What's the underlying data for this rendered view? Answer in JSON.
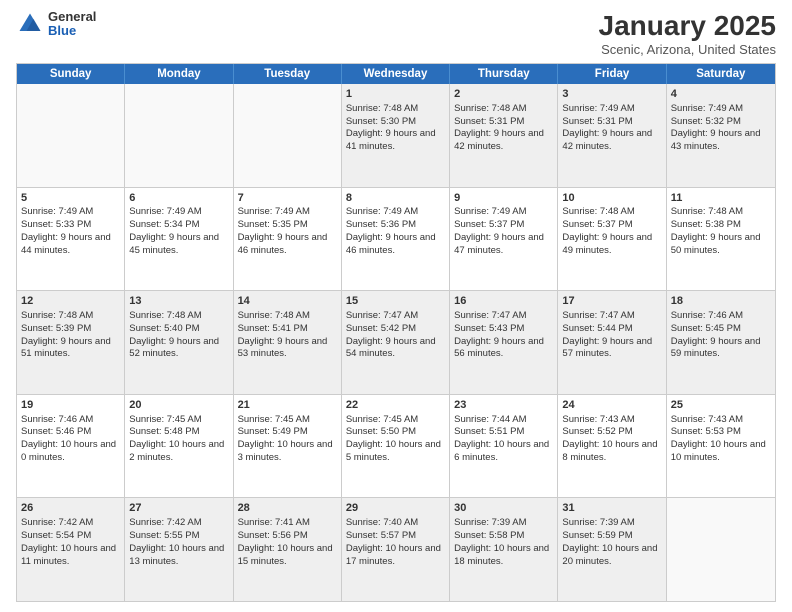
{
  "logo": {
    "general": "General",
    "blue": "Blue"
  },
  "header": {
    "title": "January 2025",
    "subtitle": "Scenic, Arizona, United States"
  },
  "weekdays": [
    "Sunday",
    "Monday",
    "Tuesday",
    "Wednesday",
    "Thursday",
    "Friday",
    "Saturday"
  ],
  "weeks": [
    [
      {
        "day": "",
        "content": "",
        "empty": true
      },
      {
        "day": "",
        "content": "",
        "empty": true
      },
      {
        "day": "",
        "content": "",
        "empty": true
      },
      {
        "day": "1",
        "content": "Sunrise: 7:48 AM\nSunset: 5:30 PM\nDaylight: 9 hours and 41 minutes.",
        "empty": false
      },
      {
        "day": "2",
        "content": "Sunrise: 7:48 AM\nSunset: 5:31 PM\nDaylight: 9 hours and 42 minutes.",
        "empty": false
      },
      {
        "day": "3",
        "content": "Sunrise: 7:49 AM\nSunset: 5:31 PM\nDaylight: 9 hours and 42 minutes.",
        "empty": false
      },
      {
        "day": "4",
        "content": "Sunrise: 7:49 AM\nSunset: 5:32 PM\nDaylight: 9 hours and 43 minutes.",
        "empty": false
      }
    ],
    [
      {
        "day": "5",
        "content": "Sunrise: 7:49 AM\nSunset: 5:33 PM\nDaylight: 9 hours and 44 minutes.",
        "empty": false
      },
      {
        "day": "6",
        "content": "Sunrise: 7:49 AM\nSunset: 5:34 PM\nDaylight: 9 hours and 45 minutes.",
        "empty": false
      },
      {
        "day": "7",
        "content": "Sunrise: 7:49 AM\nSunset: 5:35 PM\nDaylight: 9 hours and 46 minutes.",
        "empty": false
      },
      {
        "day": "8",
        "content": "Sunrise: 7:49 AM\nSunset: 5:36 PM\nDaylight: 9 hours and 46 minutes.",
        "empty": false
      },
      {
        "day": "9",
        "content": "Sunrise: 7:49 AM\nSunset: 5:37 PM\nDaylight: 9 hours and 47 minutes.",
        "empty": false
      },
      {
        "day": "10",
        "content": "Sunrise: 7:48 AM\nSunset: 5:37 PM\nDaylight: 9 hours and 49 minutes.",
        "empty": false
      },
      {
        "day": "11",
        "content": "Sunrise: 7:48 AM\nSunset: 5:38 PM\nDaylight: 9 hours and 50 minutes.",
        "empty": false
      }
    ],
    [
      {
        "day": "12",
        "content": "Sunrise: 7:48 AM\nSunset: 5:39 PM\nDaylight: 9 hours and 51 minutes.",
        "empty": false
      },
      {
        "day": "13",
        "content": "Sunrise: 7:48 AM\nSunset: 5:40 PM\nDaylight: 9 hours and 52 minutes.",
        "empty": false
      },
      {
        "day": "14",
        "content": "Sunrise: 7:48 AM\nSunset: 5:41 PM\nDaylight: 9 hours and 53 minutes.",
        "empty": false
      },
      {
        "day": "15",
        "content": "Sunrise: 7:47 AM\nSunset: 5:42 PM\nDaylight: 9 hours and 54 minutes.",
        "empty": false
      },
      {
        "day": "16",
        "content": "Sunrise: 7:47 AM\nSunset: 5:43 PM\nDaylight: 9 hours and 56 minutes.",
        "empty": false
      },
      {
        "day": "17",
        "content": "Sunrise: 7:47 AM\nSunset: 5:44 PM\nDaylight: 9 hours and 57 minutes.",
        "empty": false
      },
      {
        "day": "18",
        "content": "Sunrise: 7:46 AM\nSunset: 5:45 PM\nDaylight: 9 hours and 59 minutes.",
        "empty": false
      }
    ],
    [
      {
        "day": "19",
        "content": "Sunrise: 7:46 AM\nSunset: 5:46 PM\nDaylight: 10 hours and 0 minutes.",
        "empty": false
      },
      {
        "day": "20",
        "content": "Sunrise: 7:45 AM\nSunset: 5:48 PM\nDaylight: 10 hours and 2 minutes.",
        "empty": false
      },
      {
        "day": "21",
        "content": "Sunrise: 7:45 AM\nSunset: 5:49 PM\nDaylight: 10 hours and 3 minutes.",
        "empty": false
      },
      {
        "day": "22",
        "content": "Sunrise: 7:45 AM\nSunset: 5:50 PM\nDaylight: 10 hours and 5 minutes.",
        "empty": false
      },
      {
        "day": "23",
        "content": "Sunrise: 7:44 AM\nSunset: 5:51 PM\nDaylight: 10 hours and 6 minutes.",
        "empty": false
      },
      {
        "day": "24",
        "content": "Sunrise: 7:43 AM\nSunset: 5:52 PM\nDaylight: 10 hours and 8 minutes.",
        "empty": false
      },
      {
        "day": "25",
        "content": "Sunrise: 7:43 AM\nSunset: 5:53 PM\nDaylight: 10 hours and 10 minutes.",
        "empty": false
      }
    ],
    [
      {
        "day": "26",
        "content": "Sunrise: 7:42 AM\nSunset: 5:54 PM\nDaylight: 10 hours and 11 minutes.",
        "empty": false
      },
      {
        "day": "27",
        "content": "Sunrise: 7:42 AM\nSunset: 5:55 PM\nDaylight: 10 hours and 13 minutes.",
        "empty": false
      },
      {
        "day": "28",
        "content": "Sunrise: 7:41 AM\nSunset: 5:56 PM\nDaylight: 10 hours and 15 minutes.",
        "empty": false
      },
      {
        "day": "29",
        "content": "Sunrise: 7:40 AM\nSunset: 5:57 PM\nDaylight: 10 hours and 17 minutes.",
        "empty": false
      },
      {
        "day": "30",
        "content": "Sunrise: 7:39 AM\nSunset: 5:58 PM\nDaylight: 10 hours and 18 minutes.",
        "empty": false
      },
      {
        "day": "31",
        "content": "Sunrise: 7:39 AM\nSunset: 5:59 PM\nDaylight: 10 hours and 20 minutes.",
        "empty": false
      },
      {
        "day": "",
        "content": "",
        "empty": true
      }
    ]
  ]
}
